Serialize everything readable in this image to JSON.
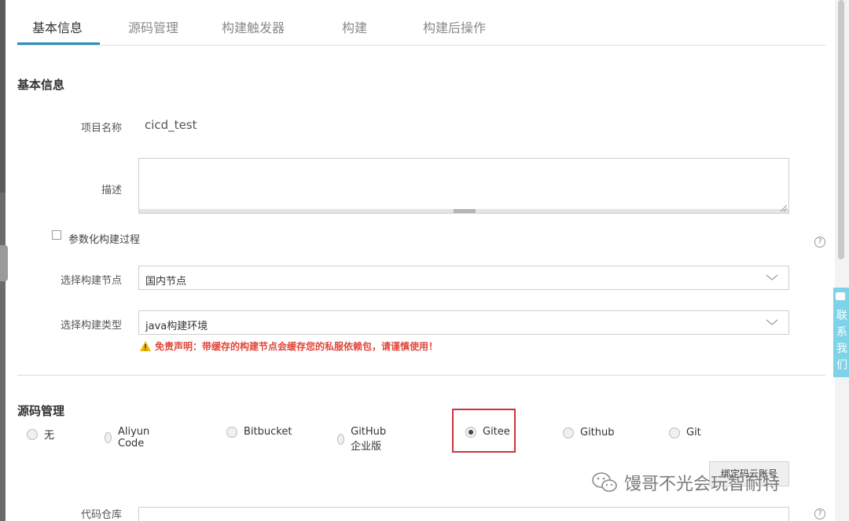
{
  "tabs": [
    {
      "label": "基本信息",
      "active": true
    },
    {
      "label": "源码管理",
      "active": false
    },
    {
      "label": "构建触发器",
      "active": false
    },
    {
      "label": "构建",
      "active": false
    },
    {
      "label": "构建后操作",
      "active": false
    }
  ],
  "basic": {
    "section_title": "基本信息",
    "project_name_label": "项目名称",
    "project_name_value": "cicd_test",
    "description_label": "描述",
    "description_value": "",
    "param_build_label": "参数化构建过程",
    "param_build_checked": false,
    "help_glyph": "?",
    "node_label": "选择构建节点",
    "node_value": "国内节点",
    "type_label": "选择构建类型",
    "type_value": "java构建环境",
    "warning_text": "免责声明：带缓存的构建节点会缓存您的私服依赖包，请谨慎使用！"
  },
  "source": {
    "section_title": "源码管理",
    "options": [
      {
        "label": "无",
        "checked": false
      },
      {
        "label": "Aliyun Code",
        "checked": false
      },
      {
        "label": "Bitbucket",
        "checked": false
      },
      {
        "label": "GitHub企业版",
        "checked": false
      },
      {
        "label": "Gitee",
        "checked": true
      },
      {
        "label": "Github",
        "checked": false
      },
      {
        "label": "Git",
        "checked": false
      }
    ],
    "bind_button_label": "绑定码云账号",
    "repo_label": "代码仓库"
  },
  "contact_widget": {
    "text": "联系我们"
  },
  "watermark": {
    "text": "馒哥不光会玩智耐特"
  },
  "colors": {
    "accent": "#2a8fbd",
    "warning": "#e1463a",
    "highlight": "#d0343a",
    "widget": "#7ed3e8"
  }
}
